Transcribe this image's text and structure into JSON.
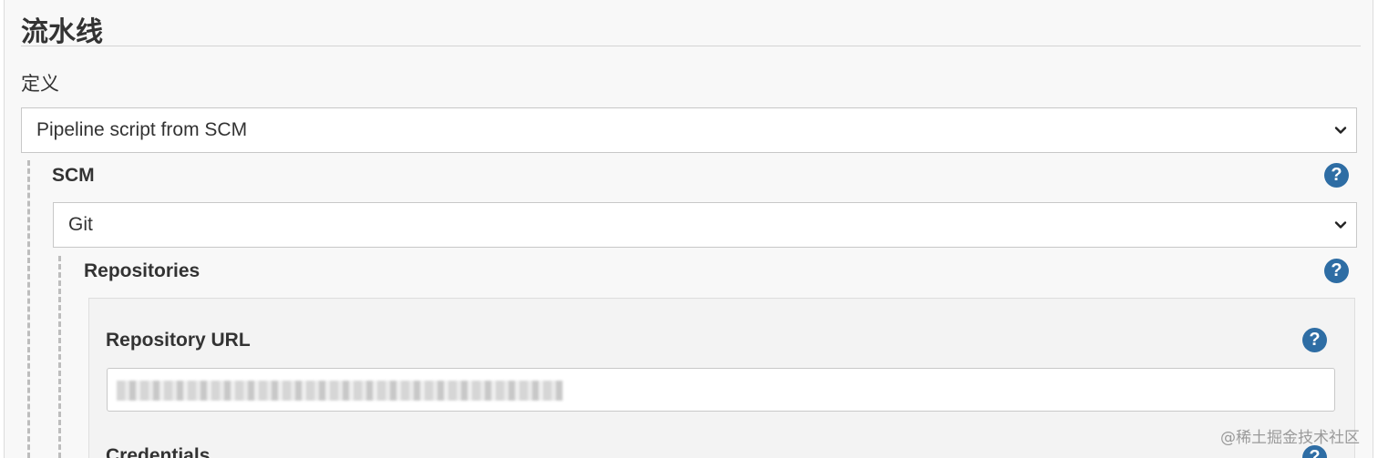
{
  "section": {
    "title": "流水线"
  },
  "definition": {
    "label": "定义",
    "selected": "Pipeline script from SCM"
  },
  "scm": {
    "label": "SCM",
    "selected": "Git"
  },
  "repositories": {
    "label": "Repositories",
    "url_label": "Repository URL",
    "url_value_obscured": true,
    "credentials_label": "Credentials"
  },
  "watermark": "@稀土掘金技术社区",
  "colors": {
    "help_icon": "#2e6da4",
    "panel_bg": "#f8f8f8"
  },
  "icons": {
    "help": "question-mark-circle",
    "dropdown": "chevron-down"
  }
}
